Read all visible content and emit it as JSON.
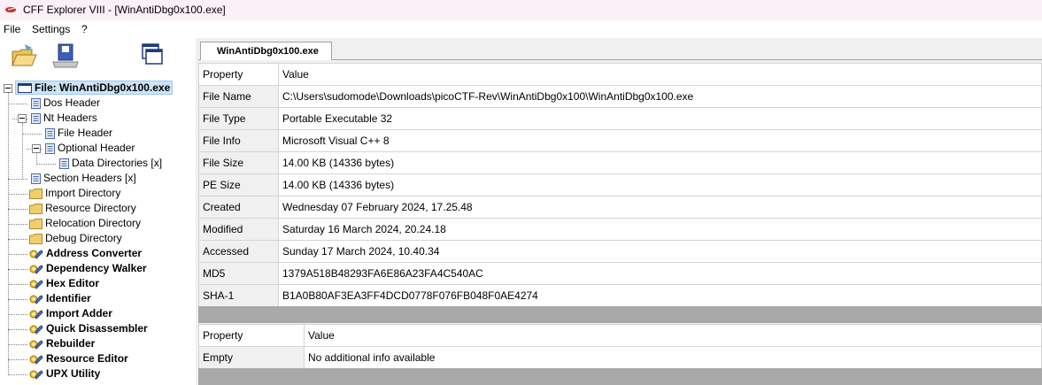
{
  "window": {
    "title": "CFF Explorer VIII - [WinAntiDbg0x100.exe]"
  },
  "menu": [
    "File",
    "Settings",
    "?"
  ],
  "toolbar": [
    {
      "icon": "open-folder-icon"
    },
    {
      "icon": "save-disk-icon"
    },
    {
      "icon": "windows-icon"
    }
  ],
  "tree": {
    "root": "File: WinAntiDbg0x100.exe",
    "dos": "Dos Header",
    "nt": "Nt Headers",
    "file_header": "File Header",
    "optional_header": "Optional Header",
    "data_dirs": "Data Directories [x]",
    "sections": "Section Headers [x]",
    "import_dir": "Import Directory",
    "resource_dir": "Resource Directory",
    "reloc_dir": "Relocation Directory",
    "debug_dir": "Debug Directory",
    "tools": [
      "Address Converter",
      "Dependency Walker",
      "Hex Editor",
      "Identifier",
      "Import Adder",
      "Quick Disassembler",
      "Rebuilder",
      "Resource Editor",
      "UPX Utility"
    ]
  },
  "tab": {
    "label": "WinAntiDbg0x100.exe"
  },
  "main_table": {
    "headers": [
      "Property",
      "Value"
    ],
    "rows": [
      [
        "File Name",
        "C:\\Users\\sudomode\\Downloads\\picoCTF-Rev\\WinAntiDbg0x100\\WinAntiDbg0x100.exe"
      ],
      [
        "File Type",
        "Portable Executable 32"
      ],
      [
        "File Info",
        "Microsoft Visual C++ 8"
      ],
      [
        "File Size",
        "14.00 KB (14336 bytes)"
      ],
      [
        "PE Size",
        "14.00 KB (14336 bytes)"
      ],
      [
        "Created",
        "Wednesday 07 February 2024, 17.25.48"
      ],
      [
        "Modified",
        "Saturday 16 March 2024, 20.24.18"
      ],
      [
        "Accessed",
        "Sunday 17 March 2024, 10.40.34"
      ],
      [
        "MD5",
        "1379A518B48293FA6E86A23FA4C540AC"
      ],
      [
        "SHA-1",
        "B1A0B80AF3EA3FF4DCD0778F076FB048F0AE4274"
      ]
    ]
  },
  "info_table": {
    "headers": [
      "Property",
      "Value"
    ],
    "rows": [
      [
        "Empty",
        "No additional info available"
      ]
    ]
  }
}
